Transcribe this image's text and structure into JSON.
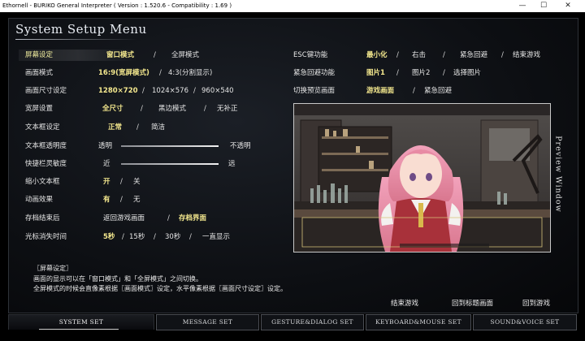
{
  "window": {
    "title": "Ethornell - BURIKO General Interpreter ( Version : 1.520.6 - Compatibility : 1.69 )"
  },
  "heading": "System Setup Menu",
  "settings": [
    {
      "label": "屏幕设定",
      "options": [
        "窗口模式",
        "全屏模式"
      ],
      "selected": 0
    },
    {
      "label": "画面模式",
      "options": [
        "16:9(宽屏模式)",
        "4:3(分割显示)"
      ],
      "selected": 0
    },
    {
      "label": "画面尺寸设定",
      "options": [
        "1280×720",
        "1024×576",
        "960×540"
      ],
      "selected": 0
    },
    {
      "label": "宽屏设置",
      "options": [
        "全尺寸",
        "黑边模式",
        "无补正"
      ],
      "selected": 0
    },
    {
      "label": "文本框设定",
      "options": [
        "正常",
        "简洁"
      ],
      "selected": 0
    },
    {
      "label": "缩小文本框",
      "options": [
        "开",
        "关"
      ],
      "selected": 0
    },
    {
      "label": "动画效果",
      "options": [
        "有",
        "无"
      ],
      "selected": 0
    },
    {
      "label": "存档结束后",
      "options": [
        "返回游戏画面",
        "存档界面"
      ],
      "selected": 1
    },
    {
      "label": "光标消失时间",
      "options": [
        "5秒",
        "15秒",
        "30秒",
        "一直显示"
      ],
      "selected": 0
    }
  ],
  "sliders": [
    {
      "label": "文本框透明度",
      "min_label": "透明",
      "max_label": "不透明",
      "value": 1.0
    },
    {
      "label": "快捷栏灵敏度",
      "min_label": "近",
      "max_label": "远",
      "value": 1.0
    }
  ],
  "right_settings": [
    {
      "label": "ESC键功能",
      "options": [
        "最小化",
        "右击",
        "紧急回避",
        "结束游戏"
      ],
      "selected": 0
    },
    {
      "label": "紧急回避功能",
      "options": [
        "图片1",
        "图片2",
        "选择图片"
      ],
      "selected": 0
    },
    {
      "label": "切换预览画面",
      "options": [
        "游戏画面",
        "紧急回避"
      ],
      "selected": 0
    }
  ],
  "preview_label": "Preview Window",
  "description": {
    "title": "〖屏幕设定〗",
    "lines": [
      "画面的显示可以在「窗口模式」和「全屏模式」之间切换。",
      "全屏模式的时候会直像素根据〖画面模式〗设定，水平像素根据〖画面尺寸设定〗设定。"
    ]
  },
  "actions": [
    "结束游戏",
    "回到标题画面",
    "回到游戏"
  ],
  "tabs": [
    "SYSTEM SET",
    "MESSAGE SET",
    "GESTURE&DIALOG SET",
    "KEYBOARD&MOUSE SET",
    "SOUND&VOICE SET"
  ],
  "active_tab": 0,
  "colors": {
    "selected_option": "#f4e88e",
    "text": "#e6e6e6",
    "background": "#0d0f13"
  }
}
